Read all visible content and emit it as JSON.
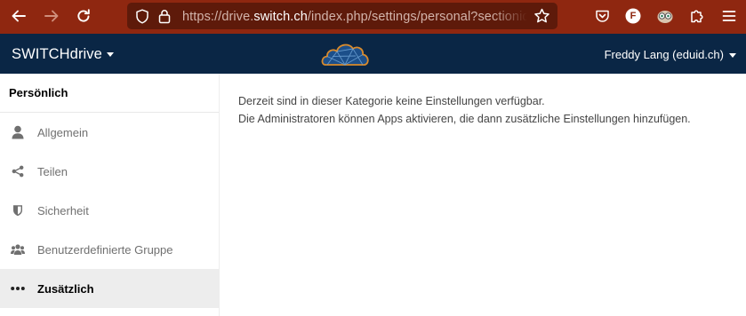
{
  "browser": {
    "url_prefix": "https://drive.",
    "url_host": "switch.ch",
    "url_suffix": "/index.php/settings/personal?sectionid=additional",
    "icons": [
      "back-icon",
      "forward-icon",
      "reload-icon",
      "shield-icon",
      "lock-icon",
      "bookmark-star-icon",
      "pocket-icon",
      "extension-f-icon",
      "extension-owl-icon",
      "extensions-puzzle-icon",
      "menu-icon"
    ],
    "toolbar_color": "#8f2710",
    "extension_f_letter": "F"
  },
  "header": {
    "app_name": "SWITCHdrive",
    "user_label": "Freddy Lang (eduid.ch)",
    "background": "#0a2645",
    "logo_icon": "cloud-logo-icon"
  },
  "sidebar": {
    "heading": "Persönlich",
    "items": [
      {
        "label": "Allgemein",
        "icon": "user-icon",
        "active": false
      },
      {
        "label": "Teilen",
        "icon": "share-icon",
        "active": false
      },
      {
        "label": "Sicherheit",
        "icon": "shield-icon",
        "active": false
      },
      {
        "label": "Benutzerdefinierte Gruppe",
        "icon": "group-icon",
        "active": false
      },
      {
        "label": "Zusätzlich",
        "icon": "more-icon",
        "active": true
      }
    ]
  },
  "main": {
    "line1": "Derzeit sind in dieser Kategorie keine Einstellungen verfügbar.",
    "line2": "Die Administratoren können Apps aktivieren, die dann zusätzliche Einstellungen hinzufügen."
  }
}
